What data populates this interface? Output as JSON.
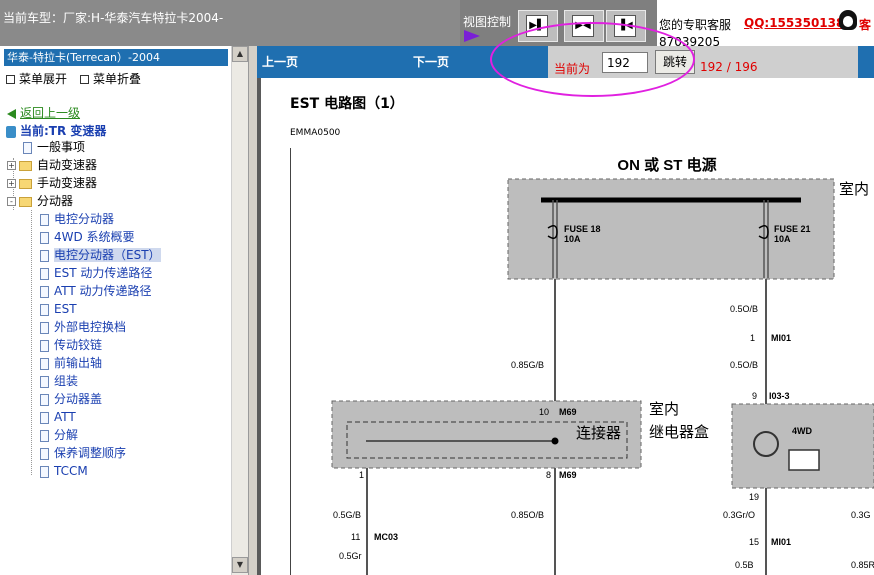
{
  "header": {
    "car_type": "当前车型：厂家:H-华泰汽车特拉卡2004-",
    "view_control_label": "视图控制",
    "view_buttons": [
      "view-single-page",
      "view-two-page",
      "view-fit-width"
    ],
    "service_label": "您的专职客服",
    "qq": "QQ:1553501388",
    "phone": "87039205",
    "service_suffix": "客"
  },
  "sidebar": {
    "title": "华泰-特拉卡(Terrecan）-2004",
    "expand_label": "菜单展开",
    "collapse_label": "菜单折叠",
    "back_label": "返回上一级",
    "current_label": "当前:TR 变速器",
    "items": [
      {
        "label": "一般事项",
        "type": "doc",
        "level": 1
      },
      {
        "label": "自动变速器",
        "type": "folder",
        "level": 0,
        "expander": "+"
      },
      {
        "label": "手动变速器",
        "type": "folder",
        "level": 0,
        "expander": "+"
      },
      {
        "label": "分动器",
        "type": "folder",
        "level": 0,
        "expander": "-"
      },
      {
        "label": "电控分动器",
        "type": "doc",
        "level": 2
      },
      {
        "label": "4WD 系统概要",
        "type": "doc",
        "level": 2
      },
      {
        "label": "电控分动器（EST）",
        "type": "doc",
        "level": 2,
        "selected": true
      },
      {
        "label": "EST 动力传递路径",
        "type": "doc",
        "level": 2
      },
      {
        "label": "ATT 动力传递路径",
        "type": "doc",
        "level": 2
      },
      {
        "label": "EST",
        "type": "doc",
        "level": 2
      },
      {
        "label": "外部电控换档",
        "type": "doc",
        "level": 2
      },
      {
        "label": "传动铰链",
        "type": "doc",
        "level": 2
      },
      {
        "label": "前输出轴",
        "type": "doc",
        "level": 2
      },
      {
        "label": "组装",
        "type": "doc",
        "level": 2
      },
      {
        "label": "分动器盖",
        "type": "doc",
        "level": 2
      },
      {
        "label": "ATT",
        "type": "doc",
        "level": 2
      },
      {
        "label": "分解",
        "type": "doc",
        "level": 2
      },
      {
        "label": "保养调整顺序",
        "type": "doc",
        "level": 2
      },
      {
        "label": "TCCM",
        "type": "doc",
        "level": 2
      }
    ]
  },
  "nav": {
    "prev_label": "上一页",
    "next_label": "下一页",
    "current_label": "当前为",
    "page_value": "192",
    "jump_label": "跳转",
    "page_total": "192 / 196"
  },
  "document": {
    "title": "EST 电路图（1）",
    "code": "EMMA0500",
    "diagram": {
      "power_title": "ON 或 ST 电源",
      "indoor_label": "室内",
      "fuse_left": "FUSE 18",
      "fuse_left_amp": "10A",
      "fuse_right": "FUSE 21",
      "fuse_right_amp": "10A",
      "wire_050b_a": "0.5O/B",
      "mi01_a": "MI01",
      "mi01_a_pin": "1",
      "wire_050b_b": "0.5O/B",
      "wire_085gb": "0.85G/B",
      "pin_9": "9",
      "i03_3": "I03-3",
      "pin_10": "10",
      "m69_a": "M69",
      "relay_room_1": "室内",
      "relay_room_2": "继电器盒",
      "connector": "连接器",
      "pin_1": "1",
      "pin_8": "8",
      "m69_b": "M69",
      "fourwd": "4WD",
      "pin_19": "19",
      "wire_05gb": "0.5G/B",
      "wire_085ob": "0.85O/B",
      "wire_03gro": "0.3Gr/O",
      "wire_03g": "0.3G",
      "pin_11": "11",
      "mc03": "MC03",
      "pin_15": "15",
      "mi01_b": "MI01",
      "wire_05gr": "0.5Gr",
      "wire_05b": "0.5B",
      "wire_085r": "0.85R"
    }
  },
  "colors": {
    "topbar": "#7f7f7f",
    "nav_blue": "#1f6fb0",
    "accent_red": "#e00000",
    "highlight_oval": "#e020e0",
    "diagram_box": "#bdbdbd"
  }
}
